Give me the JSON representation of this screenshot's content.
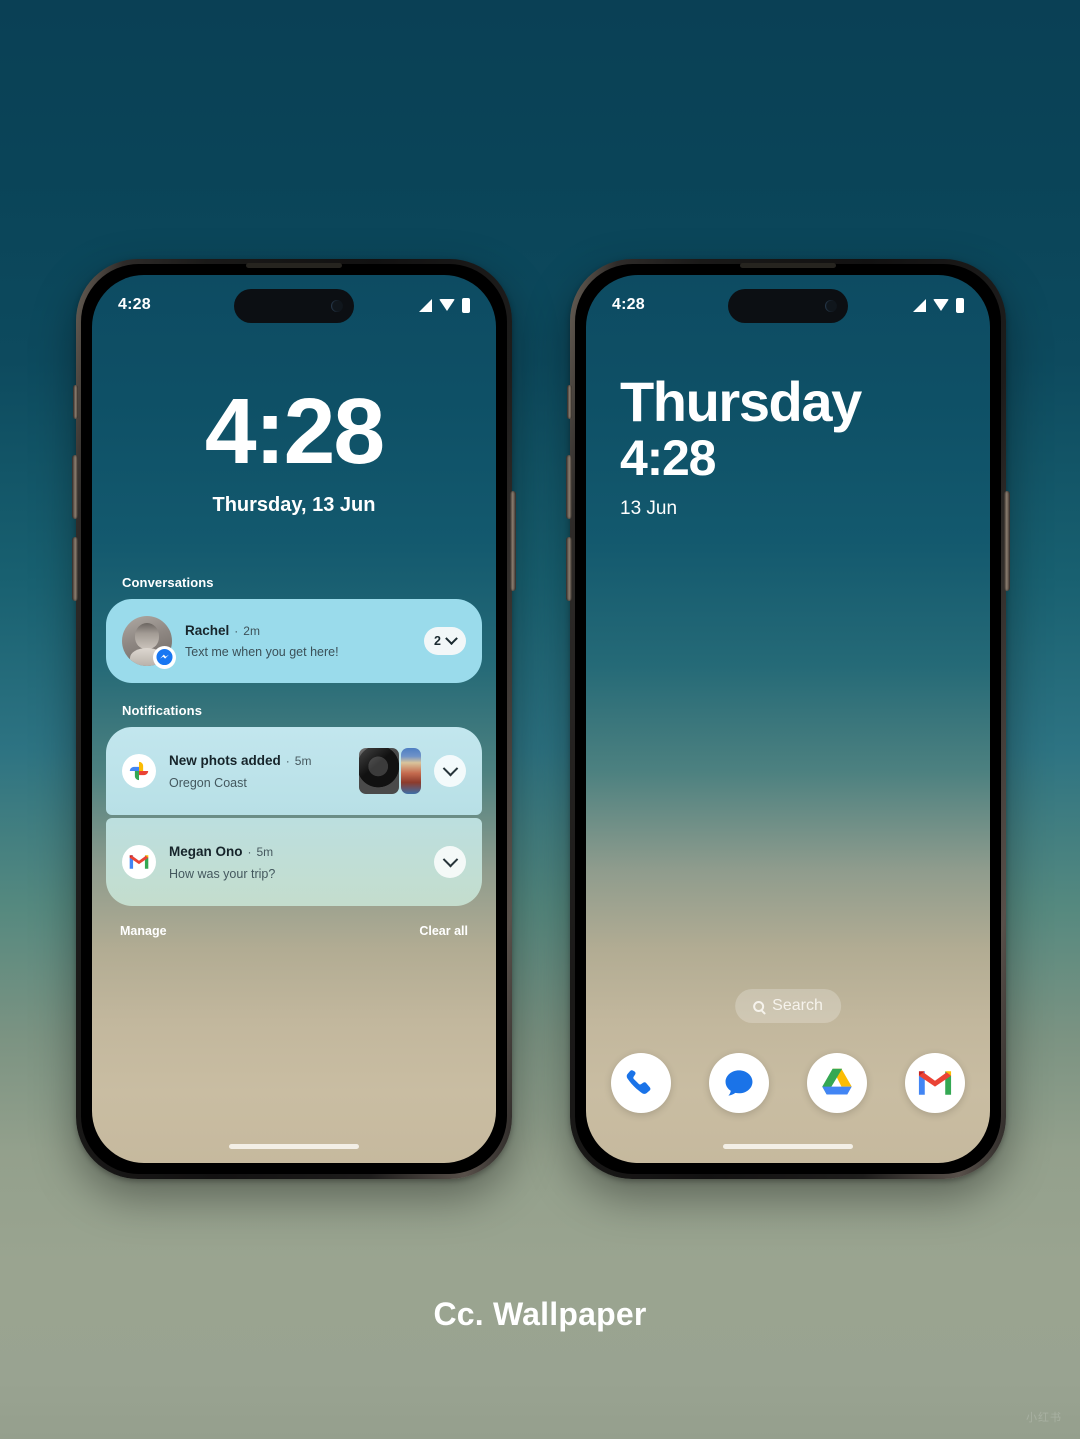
{
  "background": {
    "top_color": "#0a4055",
    "mid_color": "#2d7382",
    "bottom_color": "#99a391"
  },
  "caption": {
    "text": "Cc. Wallpaper",
    "watermark": "小红书"
  },
  "phones": {
    "left": {
      "name": "lock-screen",
      "status_bar": {
        "time": "4:28",
        "icons": [
          "signal-icon",
          "wifi-icon",
          "battery-icon"
        ]
      },
      "clock": {
        "time": "4:28",
        "date": "Thursday, 13 Jun"
      },
      "conversations": {
        "section_label": "Conversations",
        "items": [
          {
            "name": "Rachel",
            "separator": "·",
            "time": "2m",
            "message": "Text me when you get here!",
            "count": "2",
            "app_badge": "messenger-icon",
            "avatar": "rachel-avatar",
            "chevron": "chevron-down-icon"
          }
        ]
      },
      "notifications": {
        "section_label": "Notifications",
        "items": [
          {
            "app_icon": "google-photos-icon",
            "title": "New phots added",
            "separator": "·",
            "time": "5m",
            "subtitle": "Oregon Coast",
            "thumbnails": [
              "photo-thumb-bw",
              "photo-thumb-color"
            ],
            "chevron": "chevron-down-icon"
          },
          {
            "app_icon": "gmail-icon",
            "title": "Megan Ono",
            "separator": "·",
            "time": "5m",
            "subtitle": "How was your trip?",
            "thumbnails": [],
            "chevron": "chevron-down-icon"
          }
        ],
        "footer": {
          "manage_label": "Manage",
          "clear_all_label": "Clear all"
        }
      }
    },
    "right": {
      "name": "home-screen",
      "status_bar": {
        "time": "4:28",
        "icons": [
          "signal-icon",
          "wifi-icon",
          "battery-icon"
        ]
      },
      "clock": {
        "day": "Thursday",
        "time": "4:28",
        "date": "13 Jun"
      },
      "search": {
        "label": "Search",
        "icon": "search-icon"
      },
      "dock": {
        "items": [
          {
            "label": "Phone",
            "icon": "phone-icon"
          },
          {
            "label": "Messages",
            "icon": "messages-icon"
          },
          {
            "label": "Drive",
            "icon": "google-drive-icon"
          },
          {
            "label": "Gmail",
            "icon": "gmail-icon"
          }
        ]
      }
    }
  }
}
